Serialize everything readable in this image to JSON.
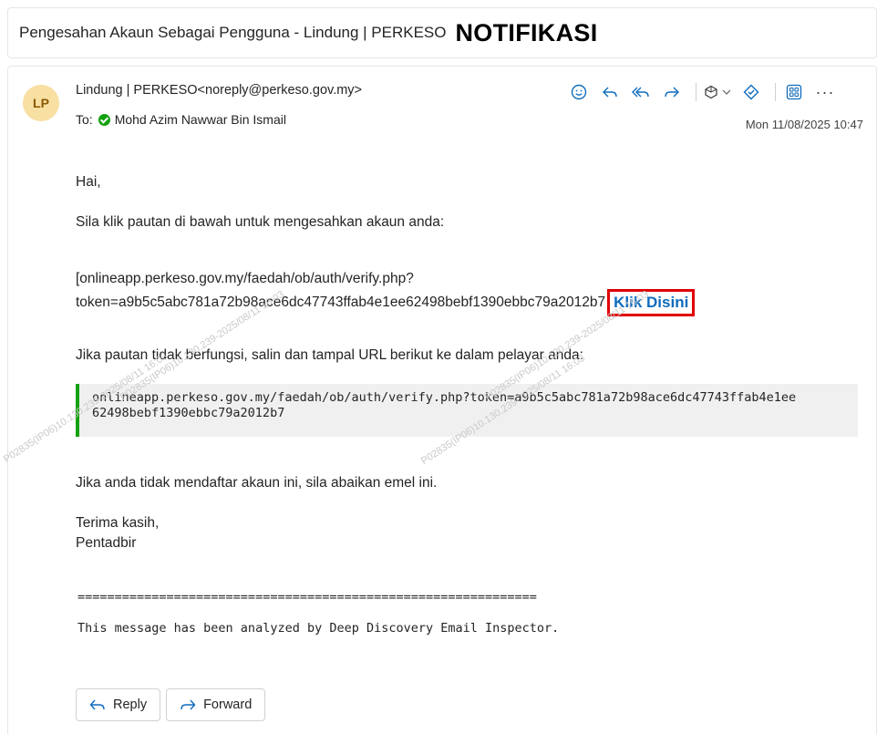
{
  "subject": {
    "title": "Pengesahan Akaun Sebagai Pengguna - Lindung | PERKESO",
    "tag": "NOTIFIKASI"
  },
  "message": {
    "avatar_initials": "LP",
    "sender": "Lindung | PERKESO<noreply@perkeso.gov.my>",
    "to_label": "To:",
    "recipient": "Mohd Azim Nawwar Bin Ismail",
    "date": "Mon 11/08/2025 10:47"
  },
  "toolbar": {
    "icons": [
      "emoji-icon",
      "reply-icon",
      "reply-all-icon",
      "forward-icon",
      "tag-icon",
      "chevron-down-icon",
      "sticker-icon",
      "apps-icon",
      "more-icon"
    ],
    "more_label": "···"
  },
  "body": {
    "greeting": "Hai,",
    "instruction": "Sila klik pautan di bawah untuk mengesahkan akaun anda:",
    "link_line1": "[onlineapp.perkeso.gov.my/faedah/ob/auth/verify.php?",
    "link_line2": "token=a9b5c5abc781a72b98ace6dc47743ffab4e1ee62498bebf1390ebbc79a2012b7",
    "klik_label": "Klik Disini",
    "fallback": "Jika pautan tidak berfungsi, salin dan tampal URL berikut ke dalam pelayar anda:",
    "url_line1": "onlineapp.perkeso.gov.my/faedah/ob/auth/verify.php?token=a9b5c5abc781a72b98ace6dc47743ffab4e1ee",
    "url_line2": "62498bebf1390ebbc79a2012b7",
    "ignore": "Jika anda tidak mendaftar akaun ini, sila abaikan emel ini.",
    "thanks": "Terima kasih,",
    "signature": "Pentadbir",
    "separator": "==============================================================",
    "scan_note": "This message has been analyzed by Deep Discovery Email Inspector."
  },
  "actions": {
    "reply_label": "Reply",
    "forward_label": "Forward"
  },
  "watermarks": {
    "w1": "P02835(IP06)10.130.239-2025/08/11 16:03",
    "w2": "P02835(IP06)10.130.239-2025/08/11 16:03",
    "w3": "P02835(IP06)10.130.239-2025/08/11 16:03",
    "w4": "P02835(IP06)10.130.239-2025/08/11 16:03"
  },
  "colors": {
    "accent": "#0f6cbd",
    "highlight_border": "#e00000",
    "verified": "#13a10e",
    "avatar_bg": "#f8dfa2"
  }
}
